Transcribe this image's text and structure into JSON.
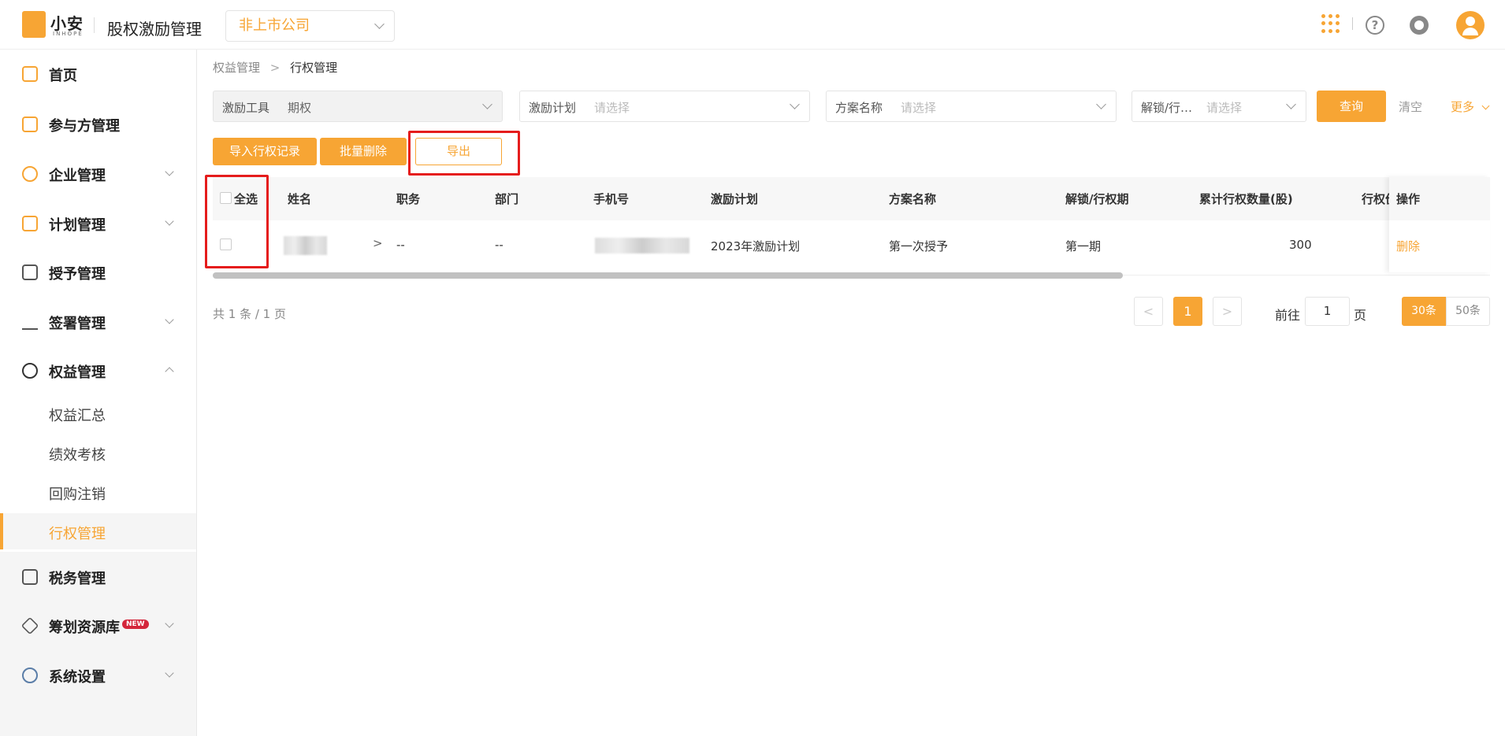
{
  "header": {
    "logo_text": "小安",
    "logo_sub": "INHOPE",
    "app_title": "股权激励管理",
    "company_select": "非上市公司",
    "icons": [
      "apps-grid-icon",
      "help-icon",
      "customer-service-icon",
      "user-avatar-icon"
    ]
  },
  "sidebar": {
    "items": [
      {
        "label": "首页",
        "icon": "home-icon"
      },
      {
        "label": "参与方管理",
        "icon": "users-icon"
      },
      {
        "label": "企业管理",
        "icon": "enterprise-icon"
      },
      {
        "label": "计划管理",
        "icon": "plan-icon"
      },
      {
        "label": "授予管理",
        "icon": "grant-icon"
      },
      {
        "label": "签署管理",
        "icon": "sign-icon"
      },
      {
        "label": "权益管理",
        "icon": "equity-icon"
      },
      {
        "label": "税务管理",
        "icon": "tax-icon"
      },
      {
        "label": "筹划资源库",
        "icon": "layers-icon",
        "badge": "NEW"
      },
      {
        "label": "系统设置",
        "icon": "settings-icon"
      }
    ],
    "sub_items": [
      {
        "label": "权益汇总"
      },
      {
        "label": "绩效考核"
      },
      {
        "label": "回购注销"
      },
      {
        "label": "行权管理",
        "active": true
      }
    ]
  },
  "breadcrumb": {
    "parent": "权益管理",
    "current": "行权管理"
  },
  "filters": [
    {
      "label": "激励工具",
      "value": "期权"
    },
    {
      "label": "激励计划",
      "placeholder": "请选择"
    },
    {
      "label": "方案名称",
      "placeholder": "请选择"
    },
    {
      "label": "解锁/行…",
      "placeholder": "请选择"
    }
  ],
  "actions": {
    "query": "查询",
    "clear": "清空",
    "more": "更多",
    "import": "导入行权记录",
    "batch_delete": "批量删除",
    "export": "导出"
  },
  "table": {
    "select_all": "全选",
    "columns": [
      "姓名",
      "职务",
      "部门",
      "手机号",
      "激励计划",
      "方案名称",
      "解锁/行权期",
      "累计行权数量(股)",
      "行权价",
      "操作"
    ],
    "rows": [
      {
        "name": "",
        "title": "--",
        "dept": "--",
        "phone": "",
        "plan": "2023年激励计划",
        "scheme": "第一次授予",
        "period": "第一期",
        "quantity": "300",
        "action": "删除"
      }
    ]
  },
  "pagination": {
    "total": "共 1 条 / 1 页",
    "current_page": "1",
    "goto_label": "前往",
    "goto_value": "1",
    "page_unit": "页",
    "sizes": [
      "30条",
      "50条"
    ]
  },
  "colors": {
    "accent": "#f7a534",
    "highlight": "#e51c1c",
    "badge": "#d4263b"
  }
}
